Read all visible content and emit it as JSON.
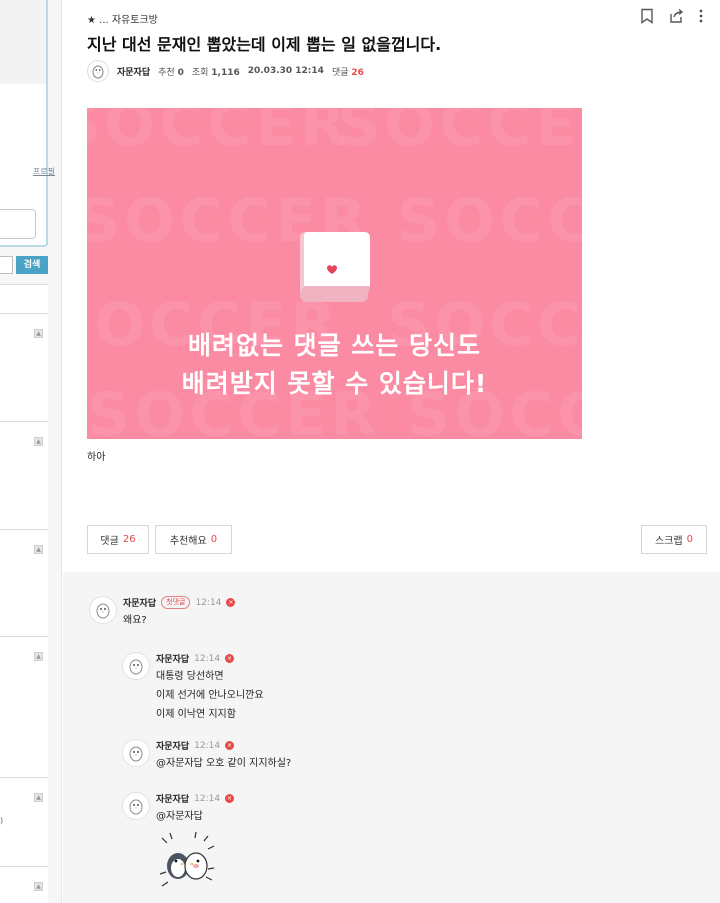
{
  "sidebar": {
    "profile_link": "프로필",
    "search_button": "검색",
    "paren_text": ")"
  },
  "post": {
    "breadcrumb": "★ ... 자유토크방",
    "title": "지난 대선 문재인 뽑았는데 이제 뽑는 일 없을껍니다.",
    "author": "자문자답",
    "recommend_label": "추천",
    "recommend_count": "0",
    "views_label": "조회",
    "views_count": "1,116",
    "date": "20.03.30 12:14",
    "comments_label": "댓글",
    "comments_count": "26",
    "body_text": "하아"
  },
  "banner": {
    "bg_word": "SOCCER",
    "line1": "배려없는 댓글 쓰는 당신도",
    "line2": "배려받지 못할 수 있습니다!",
    "colors": {
      "background": "#fb8aa3",
      "heart": "#e8435c"
    }
  },
  "actions": {
    "comment_label": "댓글",
    "comment_count": "26",
    "recommend_label": "추천해요",
    "recommend_count": "0",
    "scrap_label": "스크랩",
    "scrap_count": "0"
  },
  "comments": [
    {
      "name": "자문자답",
      "badge": "첫댓글",
      "time": "12:14",
      "lines": [
        "왜요?"
      ]
    },
    {
      "name": "자문자답",
      "time": "12:14",
      "lines": [
        "대통령 당선하면",
        "이제 선거에 안나오니깐요",
        "이제 이낙연 지지함"
      ]
    },
    {
      "name": "자문자답",
      "time": "12:14",
      "lines": [
        "@자문자답 오호 같이 지지하실?"
      ]
    },
    {
      "name": "자문자답",
      "time": "12:14",
      "lines": [
        "@자문자답"
      ]
    }
  ],
  "icons": [
    "bookmark-icon",
    "share-icon",
    "more-vertical-icon",
    "avatar-icon",
    "delete-dot-icon",
    "penguin-sticker"
  ],
  "accent_colors": {
    "red": "#e64a4a",
    "teal": "#4aa3c4"
  }
}
